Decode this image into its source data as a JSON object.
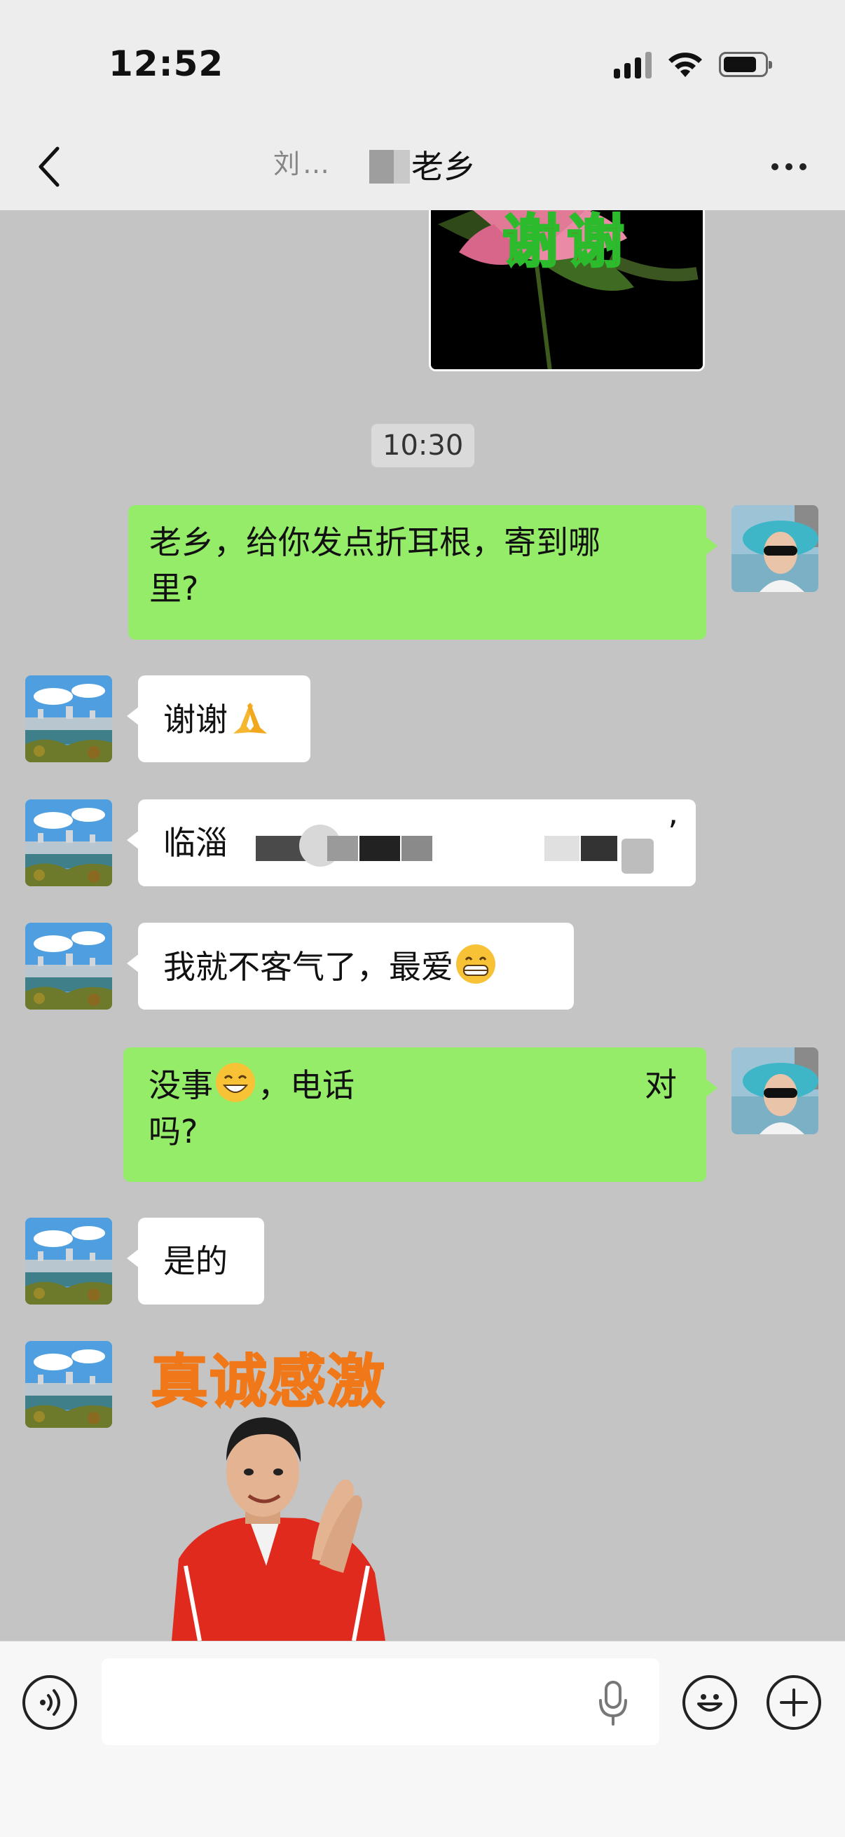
{
  "status_bar": {
    "time": "12:52"
  },
  "header": {
    "title_visible": "老乡",
    "title_ghost": "刘…"
  },
  "sticker_top": {
    "text": "谢谢"
  },
  "timestamp": "10:30",
  "messages": [
    {
      "side": "out",
      "text_line1": "老乡，给你发点折耳根，寄到哪",
      "text_line2": "里?"
    },
    {
      "side": "in",
      "text": "谢谢"
    },
    {
      "side": "in",
      "text_prefix": "临淄",
      "text_suffix": "’"
    },
    {
      "side": "in",
      "text": "我就不客气了，最爱"
    },
    {
      "side": "out",
      "text_a": "没事",
      "text_b": "，电话",
      "text_c": "对",
      "text_line2": "吗?"
    },
    {
      "side": "in",
      "text": "是的"
    }
  ],
  "sticker_bottom": {
    "text": "真诚感激"
  },
  "colors": {
    "outgoing_bubble": "#95ec69",
    "incoming_bubble": "#ffffff",
    "chat_background": "#c4c4c4",
    "bar_background": "#ededed"
  },
  "icons": {
    "back": "chevron-left-icon",
    "more": "more-dots-icon",
    "voice": "voice-wave-icon",
    "mic": "microphone-icon",
    "emoji": "smiley-face-icon",
    "plus": "plus-icon"
  }
}
